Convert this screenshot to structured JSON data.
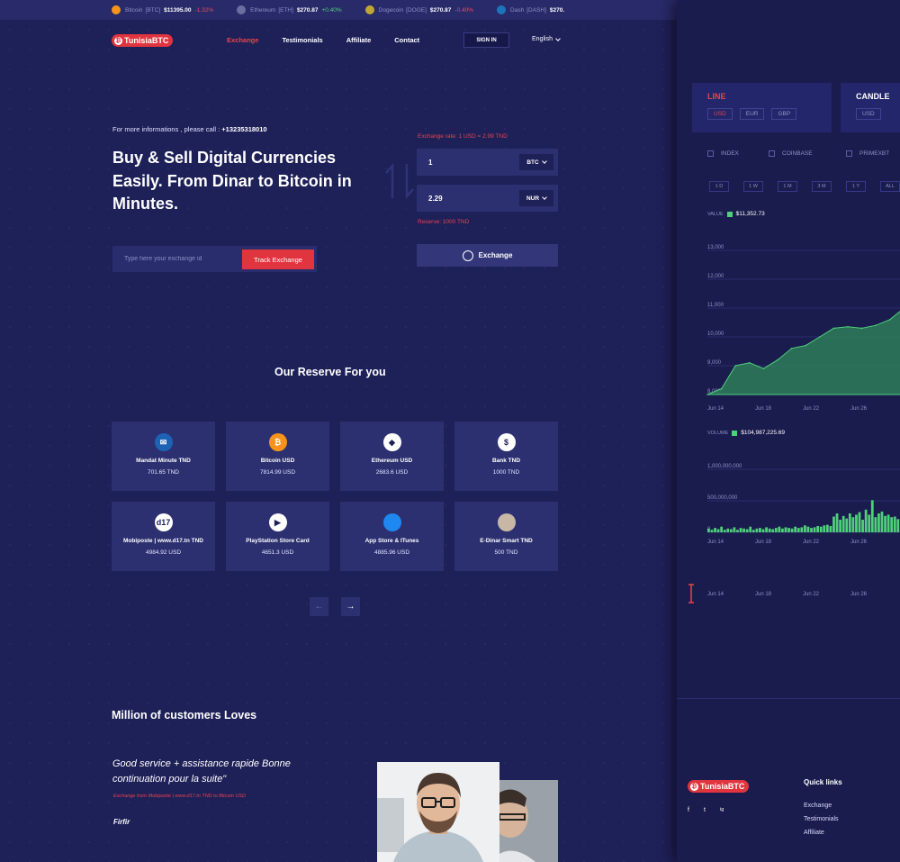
{
  "ticker": [
    {
      "icon": "bitcoin-icon",
      "color": "#f7931a",
      "name": "Bitcoin",
      "code": "[BTC]",
      "price": "$11395.00",
      "change": "-1.32%",
      "dir": "down"
    },
    {
      "icon": "ethereum-icon",
      "color": "#6b6f9f",
      "name": "Ethereum",
      "code": "[ETH]",
      "price": "$270.87",
      "change": "+0.40%",
      "dir": "up"
    },
    {
      "icon": "dogecoin-icon",
      "color": "#c2a633",
      "name": "Dogecoin",
      "code": "[DOGE]",
      "price": "$270.87",
      "change": "-0.40%",
      "dir": "down"
    },
    {
      "icon": "dash-icon",
      "color": "#1c75bc",
      "name": "Dash",
      "code": "[DASH]",
      "price": "$270.",
      "change": "",
      "dir": "up"
    }
  ],
  "brand": {
    "name": "TunisiaBTC",
    "accent": "#e0353f"
  },
  "nav": [
    "Exchange",
    "Testimonials",
    "Affiliate",
    "Contact"
  ],
  "header": {
    "signin": "SIGN IN",
    "language": "English"
  },
  "hero": {
    "call_prefix": "For more informations , please call : ",
    "phone": "+13235318010",
    "title": "Buy & Sell Digital Currencies Easily. From Dinar to Bitcoin in Minutes.",
    "track_placeholder": "Type here your exchange id",
    "track_button": "Track Exchange"
  },
  "exchange": {
    "rate": "Exchange rate: 1 USD = 2.99 TND",
    "send_amount": "1",
    "send_currency": "BTC",
    "receive_amount": "2.29",
    "receive_currency": "NUR",
    "reserve": "Reserve: 1000 TND",
    "button": "Exchange"
  },
  "reserve_section": {
    "title": "Our Reserve For you",
    "cards": [
      {
        "icon": "mandat-minute-icon",
        "color": "#1d62b5",
        "glyph": "✉",
        "name": "Mandat Minute TND",
        "amount": "701.65 TND"
      },
      {
        "icon": "bitcoin-icon",
        "color": "#f7931a",
        "glyph": "₿",
        "name": "Bitcoin USD",
        "amount": "7814.99 USD"
      },
      {
        "icon": "ethereum-icon",
        "color": "#ffffff",
        "glyph": "◆",
        "name": "Ethereum USD",
        "amount": "2683.6 USD"
      },
      {
        "icon": "bank-icon",
        "color": "#ffffff",
        "glyph": "$",
        "name": "Bank TND",
        "amount": "1000 TND"
      },
      {
        "icon": "mobiposte-icon",
        "color": "#ffffff",
        "glyph": "d17",
        "name": "Mobiposte | www.d17.tn TND",
        "amount": "4984.92 USD"
      },
      {
        "icon": "playstation-store-icon",
        "color": "#ffffff",
        "glyph": "▶",
        "name": "PlayStation Store Card",
        "amount": "4651.3 USD"
      },
      {
        "icon": "app-store-icon",
        "color": "#1e88f0",
        "glyph": "",
        "name": "App Store & ITunes",
        "amount": "4885.96 USD"
      },
      {
        "icon": "e-dinar-icon",
        "color": "#c9b7a6",
        "glyph": "",
        "name": "E-Dinar Smart TND",
        "amount": "500 TND"
      }
    ],
    "prev": "←",
    "next": "→"
  },
  "testimonials": {
    "title": "Million of customers Loves",
    "quote": "Good service + assistance rapide Bonne continuation pour la suite\"",
    "source": "Exchange from Mobiposte | www.d17.tn TND to Bitcoin USD",
    "author": "Firfir"
  },
  "right_panel": {
    "chart_modes": [
      {
        "label": "LINE",
        "currencies": [
          "USD",
          "EUR",
          "GBP"
        ]
      },
      {
        "label": "CANDLE",
        "currencies": [
          "USD"
        ]
      }
    ],
    "sources": [
      "INDEX",
      "COINBASE",
      "PRIMEXBT"
    ],
    "ranges": [
      "1 D",
      "1 W",
      "1 M",
      "3 M",
      "1 Y",
      "ALL"
    ],
    "value_label": "VALUE",
    "value": "$11,352.73",
    "volume_label": "VOLUME",
    "volume": "$104,987,225.69",
    "footer_logo": "TunisiaBTC",
    "quick_links_title": "Quick links",
    "quick_links": [
      "Exchange",
      "Testimonials",
      "Affiliate"
    ],
    "social": [
      "f",
      "t",
      "ig"
    ]
  },
  "chart_data": [
    {
      "type": "area",
      "title": "",
      "ylabel": "VALUE",
      "yticks": [
        "13,000",
        "12,000",
        "11,000",
        "10,000",
        "9,000",
        "8,000"
      ],
      "xticks": [
        "Jun 14",
        "Jun 18",
        "Jun 22",
        "Jun 26"
      ],
      "ylim": [
        8000,
        13000
      ],
      "x": [
        "Jun 14",
        "Jun 15",
        "Jun 16",
        "Jun 17",
        "Jun 18",
        "Jun 19",
        "Jun 20",
        "Jun 21",
        "Jun 22",
        "Jun 23",
        "Jun 24",
        "Jun 25",
        "Jun 26",
        "Jun 27",
        "Jun 28",
        "Jun 29"
      ],
      "values": [
        8000,
        8200,
        9000,
        9100,
        8900,
        9200,
        9600,
        9700,
        10000,
        10300,
        10350,
        10300,
        10400,
        10600,
        11000,
        11100
      ],
      "color": "#4fd07a"
    },
    {
      "type": "bar",
      "title": "",
      "ylabel": "VOLUME",
      "yticks": [
        "1,000,000,000",
        "500,000,000",
        "0"
      ],
      "xticks": [
        "Jun 14",
        "Jun 18",
        "Jun 22",
        "Jun 26"
      ],
      "ylim": [
        0,
        1000000000
      ],
      "values": [
        60000000,
        40000000,
        70000000,
        50000000,
        90000000,
        40000000,
        60000000,
        50000000,
        80000000,
        40000000,
        70000000,
        60000000,
        50000000,
        90000000,
        40000000,
        60000000,
        70000000,
        50000000,
        80000000,
        60000000,
        50000000,
        70000000,
        90000000,
        60000000,
        80000000,
        70000000,
        60000000,
        90000000,
        70000000,
        80000000,
        110000000,
        90000000,
        70000000,
        80000000,
        100000000,
        90000000,
        110000000,
        120000000,
        100000000,
        250000000,
        300000000,
        200000000,
        260000000,
        220000000,
        300000000,
        240000000,
        280000000,
        320000000,
        200000000,
        360000000,
        280000000,
        510000000,
        240000000,
        300000000,
        330000000,
        260000000,
        280000000,
        240000000,
        250000000,
        210000000
      ],
      "color": "#4fd07a"
    }
  ]
}
